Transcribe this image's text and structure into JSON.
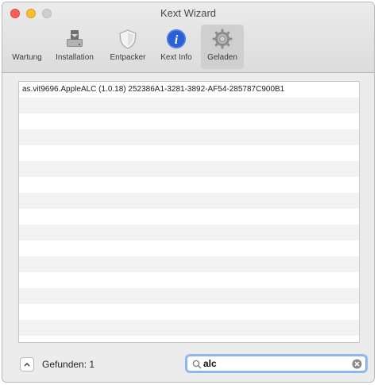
{
  "window": {
    "title": "Kext Wizard"
  },
  "toolbar": {
    "items": [
      {
        "label": "Wartung",
        "icon": "disk-icon"
      },
      {
        "label": "Installation",
        "icon": "install-icon"
      },
      {
        "label": "Entpacker",
        "icon": "shield-icon"
      },
      {
        "label": "Kext Info",
        "icon": "info-icon"
      },
      {
        "label": "Geladen",
        "icon": "gear-icon"
      }
    ],
    "selected": "Geladen"
  },
  "table": {
    "rows": [
      "as.vit9696.AppleALC (1.0.18) 252386A1-3281-3892-AF54-285787C900B1"
    ]
  },
  "footer": {
    "found_label": "Gefunden: 1"
  },
  "search": {
    "value": "alc"
  },
  "colors": {
    "close": "#fc5f57",
    "minimize": "#fdbc2e",
    "focus_ring": "#8fb7ef",
    "info_blue": "#2a5fd6"
  }
}
